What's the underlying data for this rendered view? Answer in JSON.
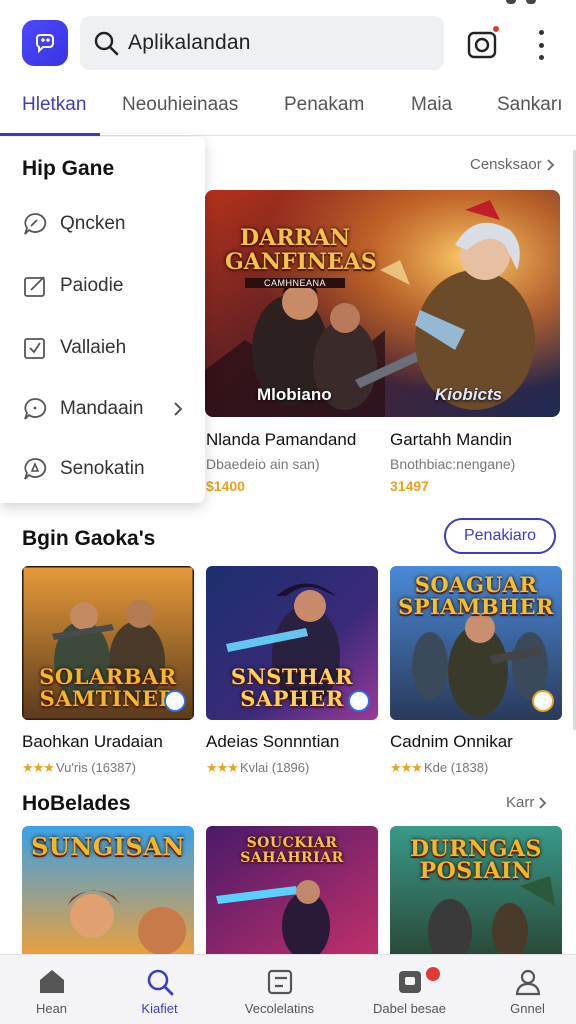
{
  "search": {
    "value": "Aplikalandan"
  },
  "tabs": [
    {
      "label": "Hletkan",
      "active": true
    },
    {
      "label": "Neouhieinaas",
      "active": false
    },
    {
      "label": "Penakam",
      "active": false
    },
    {
      "label": "Maia",
      "active": false
    },
    {
      "label": "Sankarı",
      "active": false
    }
  ],
  "menu": {
    "title": "Hip Gane",
    "items": [
      {
        "label": "Qncken",
        "icon": "chat-bubble-icon"
      },
      {
        "label": "Paiodie",
        "icon": "edit-box-icon"
      },
      {
        "label": "Vallaieh",
        "icon": "checkbox-icon"
      },
      {
        "label": "Mandaain",
        "icon": "message-icon",
        "has_submenu": true
      },
      {
        "label": "Senokatin",
        "icon": "alert-bubble-icon"
      }
    ]
  },
  "featured": {
    "see_more": "Censksaor",
    "art_title": "DARRAN GANFINEAS",
    "art_subtitle": "CAMHNEANA",
    "items": [
      {
        "art_label": "Mlobiano",
        "name": "Nlanda Pamandand",
        "sub": "Dbaedeio ain san)",
        "price": "$1400"
      },
      {
        "art_label": "Kiobicts",
        "name": "Gartahh Mandin",
        "sub": "Bnothbiac:nengane)",
        "price": "31497"
      }
    ]
  },
  "section_games": {
    "title": "Bgin Gaoka's",
    "button": "Penakiaro",
    "cards": [
      {
        "art_title": "SOLARBAR SAMTINER",
        "name": "Baohkan Uradaian",
        "stars": "★★★",
        "rating": "Vu'ris (16387)"
      },
      {
        "art_title": "SNSTHAR SAPHER",
        "name": "Adeias Sonnntian",
        "stars": "★★★",
        "rating": "Kvlai (1896)"
      },
      {
        "art_title": "SOAGUAR SPIAMBHER",
        "name": "Cadnim Onnikar",
        "stars": "★★★",
        "rating": "Kde (1838)"
      }
    ]
  },
  "section_releases": {
    "title": "HoBelades",
    "see_more": "Karr",
    "cards": [
      {
        "art_title": "SUNGISAN"
      },
      {
        "art_title": "SOUCKIAR SAHAHRIAR"
      },
      {
        "art_title": "DURNGAS POSIAIN"
      }
    ]
  },
  "bottom_nav": [
    {
      "label": "Hean",
      "icon": "home-icon",
      "active": false
    },
    {
      "label": "Kiafiet",
      "icon": "search-icon",
      "active": true
    },
    {
      "label": "Vecolelatins",
      "icon": "library-icon",
      "active": false
    },
    {
      "label": "Dabel besae",
      "icon": "downloads-icon",
      "active": false,
      "badge": true
    },
    {
      "label": "Gnnel",
      "icon": "profile-icon",
      "active": false
    }
  ],
  "colors": {
    "accent": "#3d3cc4",
    "price": "#e8a21b",
    "badge": "#e53935"
  }
}
